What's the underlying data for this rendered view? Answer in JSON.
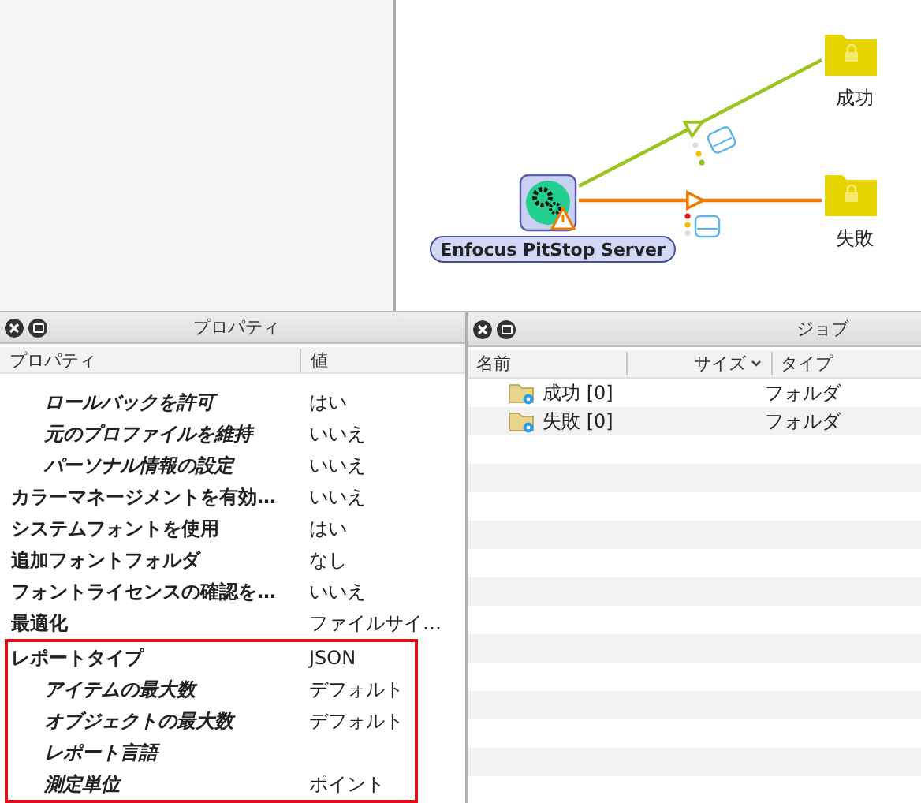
{
  "flow": {
    "node": {
      "label": "Enfocus PitStop Server",
      "warning": true
    },
    "outputs": [
      {
        "label": "成功",
        "kind": "success"
      },
      {
        "label": "失敗",
        "kind": "error"
      }
    ]
  },
  "properties": {
    "title": "プロパティ",
    "columns": [
      "プロパティ",
      "値"
    ],
    "rows": [
      {
        "name": "ロールバックを許可",
        "value": "はい",
        "kind": "sub"
      },
      {
        "name": "元のプロファイルを維持",
        "value": "いいえ",
        "kind": "sub"
      },
      {
        "name": "パーソナル情報の設定",
        "value": "いいえ",
        "kind": "sub"
      },
      {
        "name": "カラーマネージメントを有効…",
        "value": "いいえ",
        "kind": "main"
      },
      {
        "name": "システムフォントを使用",
        "value": "はい",
        "kind": "main"
      },
      {
        "name": "追加フォントフォルダ",
        "value": "なし",
        "kind": "main"
      },
      {
        "name": "フォントライセンスの確認を…",
        "value": "いいえ",
        "kind": "main"
      },
      {
        "name": "最適化",
        "value": "ファイルサイ…",
        "kind": "main"
      }
    ],
    "highlighted_rows": [
      {
        "name": "レポートタイプ",
        "value": "JSON",
        "kind": "main"
      },
      {
        "name": "アイテムの最大数",
        "value": "デフォルト",
        "kind": "sub"
      },
      {
        "name": "オブジェクトの最大数",
        "value": "デフォルト",
        "kind": "sub"
      },
      {
        "name": "レポート言語",
        "kind": "sub"
      },
      {
        "name": "測定単位",
        "value": "ポイント",
        "kind": "sub"
      }
    ]
  },
  "jobs": {
    "title": "ジョブ",
    "columns": [
      "名前",
      "サイズ",
      "タイプ"
    ],
    "rows": [
      {
        "name": "成功 [0]",
        "type": "フォルダ"
      },
      {
        "name": "失敗 [0]",
        "type": "フォルダ"
      }
    ]
  }
}
